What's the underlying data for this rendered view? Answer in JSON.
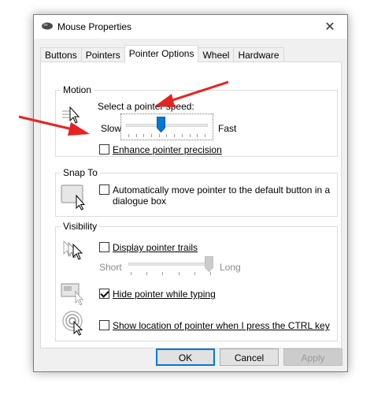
{
  "window": {
    "title": "Mouse Properties"
  },
  "tabs": [
    {
      "label": "Buttons"
    },
    {
      "label": "Pointers"
    },
    {
      "label": "Pointer Options",
      "active": true
    },
    {
      "label": "Wheel"
    },
    {
      "label": "Hardware"
    }
  ],
  "motion": {
    "group_label": "Motion",
    "speed_label": "Select a pointer speed:",
    "slow_label": "Slow",
    "fast_label": "Fast",
    "speed_level": 0.42,
    "enhance_label": "Enhance pointer precision",
    "enhance_checked": false
  },
  "snap_to": {
    "group_label": "Snap To",
    "label_line1": "Automatically move pointer to the default button in a",
    "label_line2": "dialogue box",
    "checked": false
  },
  "visibility": {
    "group_label": "Visibility",
    "trails_label": "Display pointer trails",
    "trails_checked": false,
    "short_label": "Short",
    "long_label": "Long",
    "trail_level": 1.0,
    "hide_label": "Hide pointer while typing",
    "hide_checked": true,
    "show_location_label": "Show location of pointer when I press the CTRL key",
    "show_location_checked": false
  },
  "buttons": {
    "ok": "OK",
    "cancel": "Cancel",
    "apply": "Apply"
  },
  "colors": {
    "accent": "#0078d7",
    "annotation_arrow": "#e52321"
  }
}
